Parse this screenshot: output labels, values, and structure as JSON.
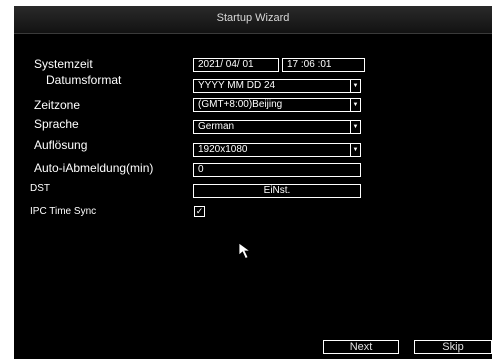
{
  "window": {
    "title": "Startup Wizard"
  },
  "fields": {
    "systemzeit": {
      "label": "Systemzeit",
      "date": "2021/ 04/ 01",
      "time": "17 :06 :01"
    },
    "datumsformat": {
      "label": "Datumsformat",
      "value": "YYYY MM DD 24"
    },
    "zeitzone": {
      "label": "Zeitzone",
      "value": "(GMT+8:00)Beijing"
    },
    "sprache": {
      "label": "Sprache",
      "value": "German"
    },
    "aufloesung": {
      "label": "Auflösung",
      "value": "1920x1080"
    },
    "auto_abmeldung": {
      "label": "Auto-iAbmeldung(min)",
      "value": "0"
    },
    "dst": {
      "label": "DST",
      "button": "EiNst."
    },
    "ipc_time_sync": {
      "label": "IPC Time Sync",
      "checked": true,
      "check_glyph": "✓"
    }
  },
  "buttons": {
    "next": "Next",
    "skip": "Skip"
  },
  "icons": {
    "dropdown": "chevron-down-icon",
    "cursor": "mouse-pointer-icon"
  },
  "colors": {
    "background": "#000000",
    "foreground": "#ffffff",
    "title_bar": "#1c1c1c"
  }
}
